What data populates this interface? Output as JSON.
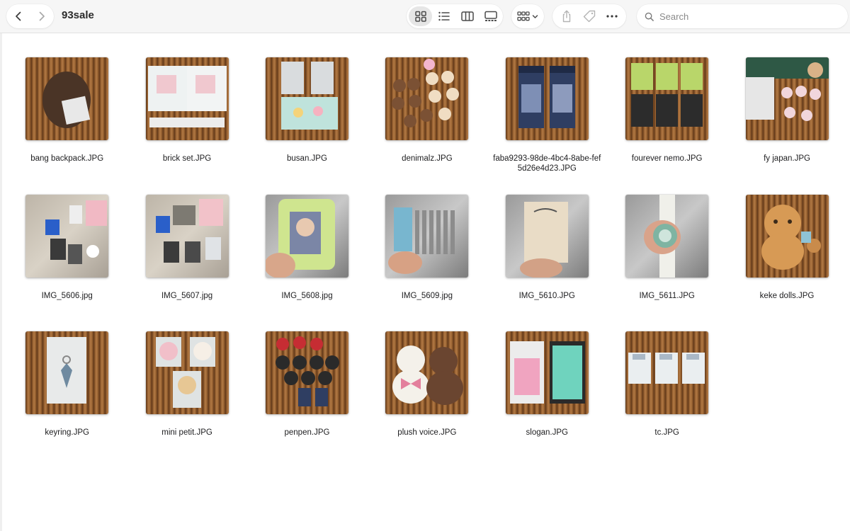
{
  "window": {
    "title": "93sale"
  },
  "toolbar": {
    "back_icon": "chevron-left-icon",
    "forward_icon": "chevron-right-icon",
    "views": [
      {
        "name": "icon-view",
        "icon": "grid-icon",
        "active": true
      },
      {
        "name": "list-view",
        "icon": "list-icon",
        "active": false
      },
      {
        "name": "column-view",
        "icon": "columns-icon",
        "active": false
      },
      {
        "name": "gallery-view",
        "icon": "gallery-icon",
        "active": false
      }
    ],
    "group_icon": "group-grid-icon",
    "actions": [
      "share-icon",
      "tag-icon",
      "more-icon"
    ]
  },
  "search": {
    "placeholder": "Search",
    "value": ""
  },
  "files": [
    {
      "name": "bang backpack.JPG"
    },
    {
      "name": "brick set.JPG"
    },
    {
      "name": "busan.JPG"
    },
    {
      "name": "denimalz.JPG"
    },
    {
      "name": "faba9293-98de-4bc4-8abe-fef5d26e4d23.JPG"
    },
    {
      "name": "fourever nemo.JPG"
    },
    {
      "name": "fy japan.JPG"
    },
    {
      "name": "IMG_5606.jpg"
    },
    {
      "name": "IMG_5607.jpg"
    },
    {
      "name": "IMG_5608.jpg"
    },
    {
      "name": "IMG_5609.jpg"
    },
    {
      "name": "IMG_5610.JPG"
    },
    {
      "name": "IMG_5611.JPG"
    },
    {
      "name": "keke dolls.JPG"
    },
    {
      "name": "keyring.JPG"
    },
    {
      "name": "mini petit.JPG"
    },
    {
      "name": "penpen.JPG"
    },
    {
      "name": "plush voice.JPG"
    },
    {
      "name": "slogan.JPG"
    },
    {
      "name": "tc.JPG"
    }
  ],
  "colors": {
    "toolbar_bg": "#f6f6f6",
    "active_view_bg": "#e6e6e6",
    "icon": "#5a5a5a"
  }
}
